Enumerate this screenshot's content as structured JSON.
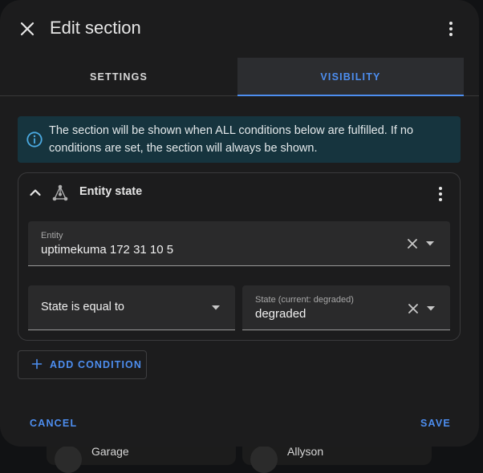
{
  "header": {
    "title": "Edit section",
    "close_icon": "close-icon",
    "menu_icon": "more-vertical-icon"
  },
  "tabs": [
    {
      "label": "SETTINGS",
      "active": false
    },
    {
      "label": "VISIBILITY",
      "active": true
    }
  ],
  "info": {
    "icon": "info-icon",
    "text": "The section will be shown when ALL conditions below are fulfilled. If no conditions are set, the section will always be shown."
  },
  "condition": {
    "title": "Entity state",
    "icon": "entity-state-icon",
    "entity": {
      "label": "Entity",
      "value": "uptimekuma 172 31 10 5"
    },
    "operator": {
      "value": "State is equal to"
    },
    "state": {
      "label": "State (current: degraded)",
      "value": "degraded"
    }
  },
  "add_condition": {
    "label": "ADD CONDITION"
  },
  "footer": {
    "cancel": "CANCEL",
    "save": "SAVE"
  },
  "background_cards": [
    {
      "label": "Garage"
    },
    {
      "label": "Allyson"
    }
  ],
  "colors": {
    "accent": "#4d8ef0",
    "dialog": "#1c1c1d",
    "info_bg": "#16343e"
  }
}
